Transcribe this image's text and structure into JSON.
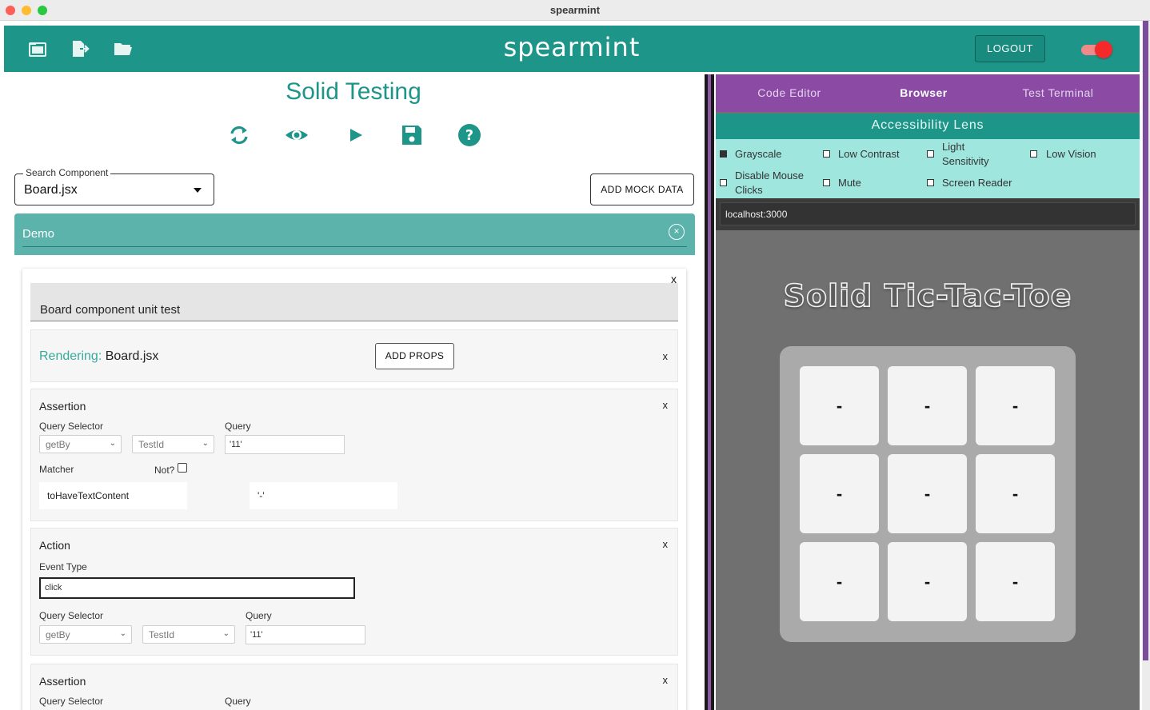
{
  "window": {
    "title": "spearmint"
  },
  "appbar": {
    "brand": "spearmint",
    "logout_label": "LOGOUT",
    "icons": [
      "new-file-icon",
      "export-file-icon",
      "open-folder-icon"
    ],
    "toggle_on": true,
    "accent": "#1e9589"
  },
  "left": {
    "page_title": "Solid Testing",
    "action_icons": [
      "refresh-icon",
      "eye-icon",
      "play-icon",
      "save-icon",
      "help-icon"
    ],
    "search": {
      "label": "Search Component",
      "value": "Board.jsx"
    },
    "mock_button": "ADD MOCK DATA",
    "demo": {
      "label": "Demo"
    },
    "test": {
      "describe": "Board component unit test",
      "rendering": {
        "label": "Rendering:",
        "value": "Board.jsx",
        "add_props": "ADD PROPS"
      },
      "assertion1": {
        "title": "Assertion",
        "query_selector_label": "Query Selector",
        "query_selector_value": "getBy",
        "query_type_value": "TestId",
        "query_label": "Query",
        "query_value": "'11'",
        "matcher_label": "Matcher",
        "not_label": "Not?",
        "matcher_value": "toHaveTextContent",
        "matcher_arg": "'-'"
      },
      "action": {
        "title": "Action",
        "event_type_label": "Event Type",
        "event_type_value": "click",
        "query_selector_label": "Query Selector",
        "query_selector_value": "getBy",
        "query_type_value": "TestId",
        "query_label": "Query",
        "query_value": "'11'"
      },
      "assertion2": {
        "title": "Assertion",
        "query_selector_label": "Query Selector",
        "query_label": "Query"
      },
      "close_glyph": "x"
    }
  },
  "right": {
    "tabs": [
      "Code Editor",
      "Browser",
      "Test Terminal"
    ],
    "active_tab": "Browser",
    "accessibility_title": "Accessibility Lens",
    "options": {
      "grayscale": "Grayscale",
      "low_contrast": "Low Contrast",
      "light_sensitivity_1": "Light",
      "light_sensitivity_2": "Sensitivity",
      "low_vision": "Low Vision",
      "disable_mouse_1": "Disable Mouse",
      "disable_mouse_2": "Clicks",
      "mute": "Mute",
      "screen_reader": "Screen Reader"
    },
    "url": "localhost:3000",
    "game": {
      "title": "Solid Tic-Tac-Toe",
      "cells": [
        "-",
        "-",
        "-",
        "-",
        "-",
        "-",
        "-",
        "-",
        "-"
      ]
    }
  }
}
